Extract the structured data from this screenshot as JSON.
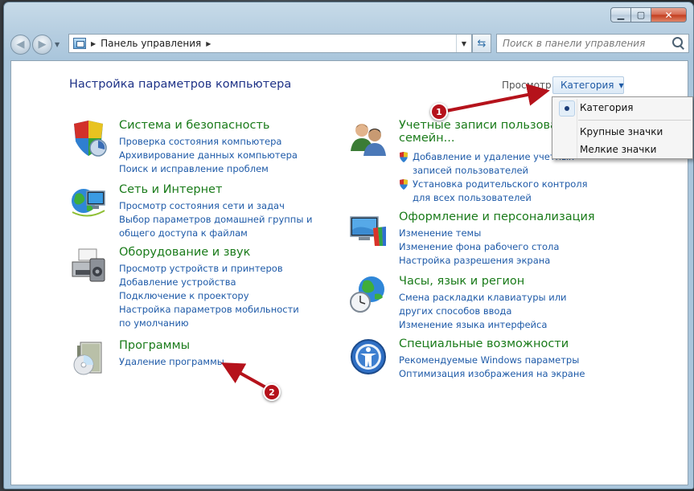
{
  "window": {
    "caption": {
      "minimize": "▁",
      "maximize": "▢",
      "close": "✕"
    }
  },
  "navbar": {
    "breadcrumb": [
      "Панель управления"
    ],
    "search_placeholder": "Поиск в панели управления"
  },
  "content": {
    "title": "Настройка параметров компьютера",
    "view_label": "Просмотр:",
    "view_value": "Категория",
    "view_options": [
      "Категория",
      "Крупные значки",
      "Мелкие значки"
    ]
  },
  "categories_left": [
    {
      "title": "Система и безопасность",
      "icon": "shield-icon",
      "links": [
        "Проверка состояния компьютера",
        "Архивирование данных компьютера",
        "Поиск и исправление проблем"
      ]
    },
    {
      "title": "Сеть и Интернет",
      "icon": "network-globe-icon",
      "links": [
        "Просмотр состояния сети и задач",
        "Выбор параметров домашней группы и общего доступа к файлам"
      ]
    },
    {
      "title": "Оборудование и звук",
      "icon": "printer-icon",
      "links": [
        "Просмотр устройств и принтеров",
        "Добавление устройства",
        "Подключение к проектору",
        "Настройка параметров мобильности по умолчанию"
      ]
    },
    {
      "title": "Программы",
      "icon": "programs-icon",
      "links": [
        "Удаление программы"
      ]
    }
  ],
  "categories_right": [
    {
      "title": "Учетные записи пользователей и семейн...",
      "title_line1": "Учетные записи пользоват",
      "title_line2": "семейн...",
      "icon": "users-icon",
      "links": [
        "Добавление и удаление учетных записей пользователей",
        "Установка родительского контроля для всех пользователей"
      ]
    },
    {
      "title": "Оформление и персонализация",
      "icon": "personalization-icon",
      "links": [
        "Изменение темы",
        "Изменение фона рабочего стола",
        "Настройка разрешения экрана"
      ]
    },
    {
      "title": "Часы, язык и регион",
      "icon": "clock-globe-icon",
      "links": [
        "Смена раскладки клавиатуры или других способов ввода",
        "Изменение языка интерфейса"
      ]
    },
    {
      "title": "Специальные возможности",
      "icon": "accessibility-icon",
      "links": [
        "Рекомендуемые Windows параметры",
        "Оптимизация изображения на экране"
      ]
    }
  ],
  "annotations": {
    "badge1": "1",
    "badge2": "2"
  },
  "colors": {
    "title_green": "#1a7b1a",
    "link_blue": "#1e5aa8",
    "heading_blue": "#1e3287",
    "annotation_red": "#b5121b"
  }
}
